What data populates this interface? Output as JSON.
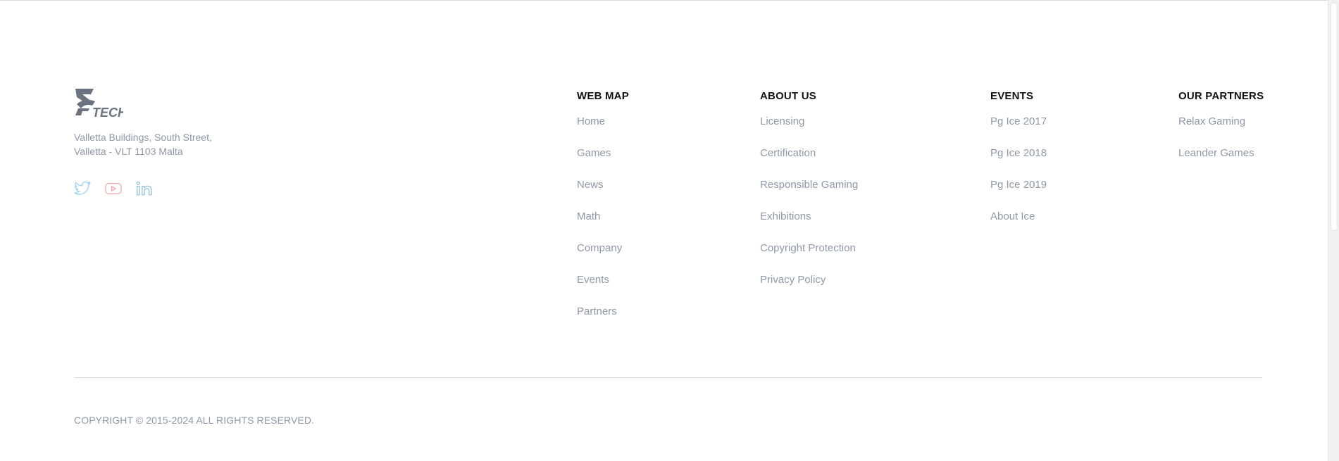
{
  "brand": {
    "logo_text": "TECH",
    "address_line1": "Valletta Buildings, South Street,",
    "address_line2": "Valletta - VLT 1103 Malta"
  },
  "socials": [
    {
      "icon": "twitter-icon",
      "color": "#9fd3ef"
    },
    {
      "icon": "youtube-icon",
      "color": "#f2a7a0"
    },
    {
      "icon": "linkedin-icon",
      "color": "#9cc4dc"
    }
  ],
  "columns": {
    "web_map": {
      "title": "WEB MAP",
      "links": [
        "Home",
        "Games",
        "News",
        "Math",
        "Company",
        "Events",
        "Partners"
      ]
    },
    "about_us": {
      "title": "ABOUT US",
      "links": [
        "Licensing",
        "Certification",
        "Responsible Gaming",
        "Exhibitions",
        "Copyright Protection",
        "Privacy Policy"
      ]
    },
    "events": {
      "title": "EVENTS",
      "links": [
        "Pg Ice 2017",
        "Pg Ice 2018",
        "Pg Ice 2019",
        "About Ice"
      ]
    },
    "partners": {
      "title": "OUR PARTNERS",
      "links": [
        "Relax Gaming",
        "Leander Games"
      ]
    }
  },
  "copyright": "COPYRIGHT © 2015-2024 ALL RIGHTS RESERVED.",
  "colors": {
    "link": "#8f98a6",
    "heading": "#111111",
    "logo": "#6b7380"
  }
}
